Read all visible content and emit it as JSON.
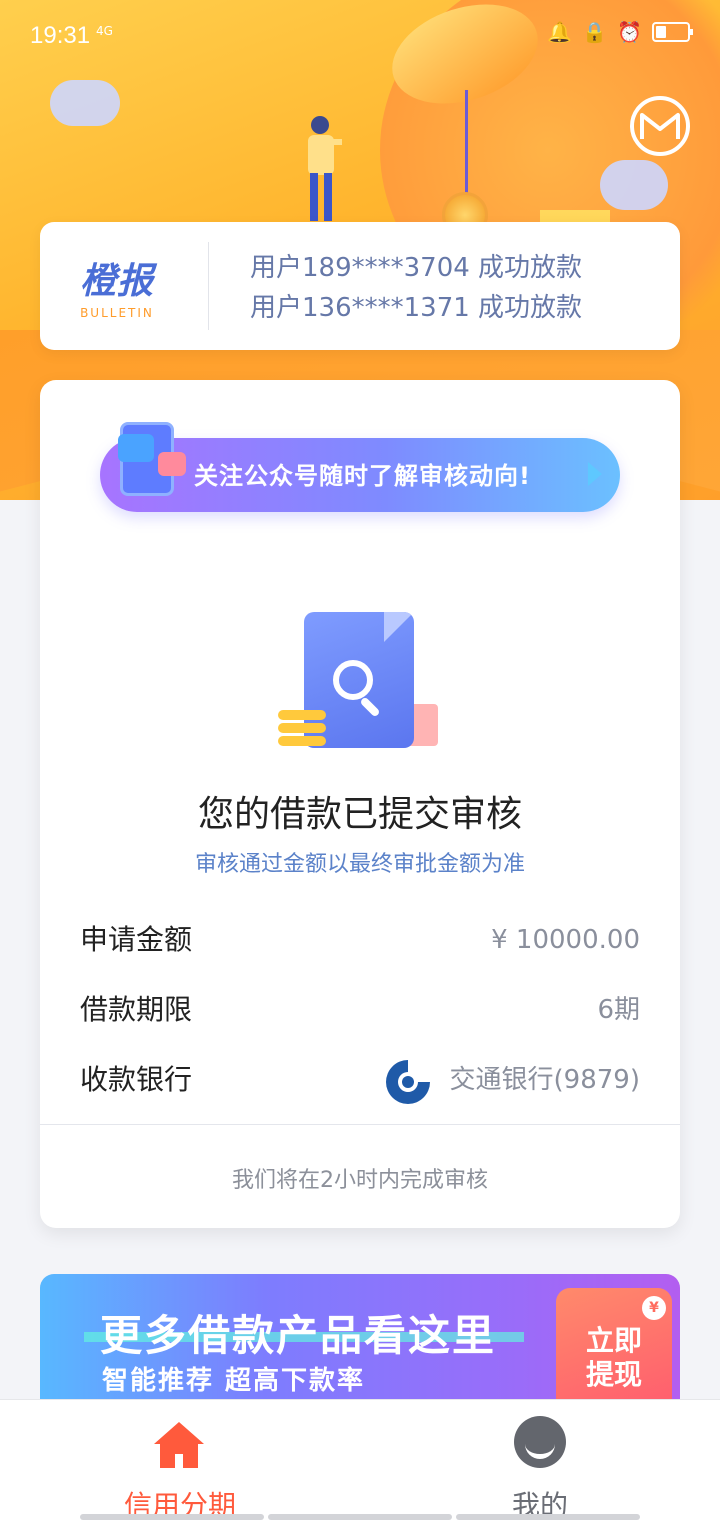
{
  "status_bar": {
    "time": "19:31",
    "network": "4G"
  },
  "news": {
    "brand_cn": "橙报",
    "brand_en": "BULLETIN",
    "items": [
      "用户189****3704 成功放款",
      "用户136****1371 成功放款"
    ]
  },
  "wechat_banner": {
    "text": "关注公众号随时了解审核动向!"
  },
  "review": {
    "title": "您的借款已提交审核",
    "subtitle": "审核通过金额以最终审批金额为准",
    "rows": [
      {
        "label": "申请金额",
        "value": "¥ 10000.00"
      },
      {
        "label": "借款期限",
        "value": "6期"
      },
      {
        "label": "收款银行",
        "value": "交通银行(9879)"
      }
    ],
    "note": "我们将在2小时内完成审核"
  },
  "promo": {
    "title": "更多借款产品看这里",
    "subtitle": "智能推荐 超高下款率",
    "button_line1": "立即",
    "button_line2": "提现",
    "badge": "¥"
  },
  "tabs": [
    {
      "label": "信用分期",
      "icon": "home-icon",
      "active": true
    },
    {
      "label": "我的",
      "icon": "user-icon",
      "active": false
    }
  ],
  "colors": {
    "accent": "#ff5a3c",
    "hero": "#ffb52e",
    "link_blue": "#5b82c9"
  }
}
